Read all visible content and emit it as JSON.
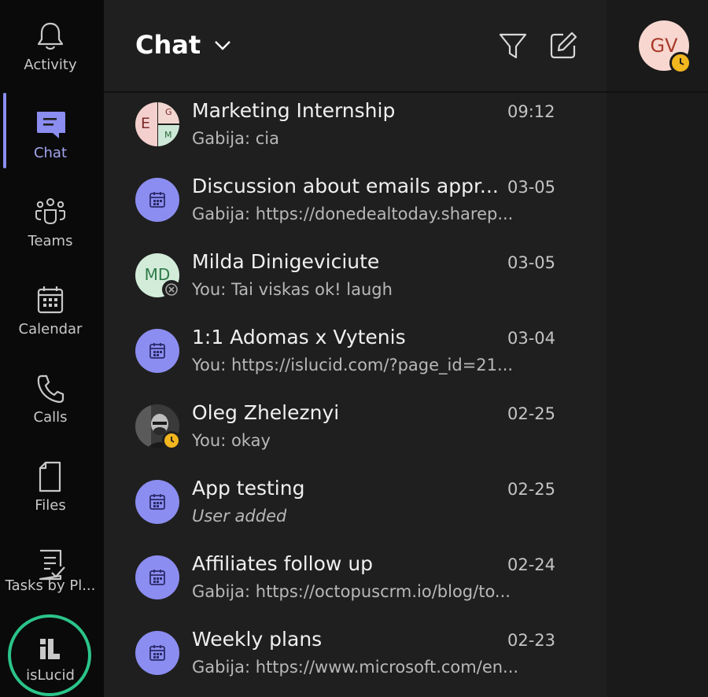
{
  "rail": {
    "items": [
      {
        "label": "Activity",
        "icon": "bell-icon"
      },
      {
        "label": "Chat",
        "icon": "chat-icon",
        "active": true
      },
      {
        "label": "Teams",
        "icon": "teams-icon"
      },
      {
        "label": "Calendar",
        "icon": "calendar-icon"
      },
      {
        "label": "Calls",
        "icon": "phone-icon"
      },
      {
        "label": "Files",
        "icon": "file-icon"
      },
      {
        "label": "Tasks by Pl...",
        "icon": "tasks-icon"
      },
      {
        "label": "isLucid",
        "icon": "islucid-icon"
      }
    ]
  },
  "header": {
    "title": "Chat"
  },
  "me": {
    "initials": "GV",
    "status": "away"
  },
  "chats": [
    {
      "name": "Marketing Internship",
      "time": "09:12",
      "preview": "Gabija: cia",
      "avatar_type": "group",
      "avatar_letters": {
        "main": "E",
        "top": "G",
        "bottom": "M"
      }
    },
    {
      "name": "Discussion about emails appr...",
      "time": "03-05",
      "preview": "Gabija: https://donedealtoday.sharep...",
      "avatar_type": "meeting"
    },
    {
      "name": "Milda Dinigeviciute",
      "time": "03-05",
      "preview": "You: Tai viskas ok! laugh",
      "avatar_type": "initials",
      "avatar_initials": "MD",
      "status": "offline"
    },
    {
      "name": "1:1 Adomas x Vytenis",
      "time": "03-04",
      "preview": "You: https://islucid.com/?page_id=21...",
      "avatar_type": "meeting"
    },
    {
      "name": "Oleg Zheleznyi",
      "time": "02-25",
      "preview": "You: okay",
      "avatar_type": "photo",
      "status": "away"
    },
    {
      "name": "App testing",
      "time": "02-25",
      "preview": "User added",
      "preview_italic": true,
      "avatar_type": "meeting"
    },
    {
      "name": "Affiliates follow up",
      "time": "02-24",
      "preview": "Gabija: https://octopuscrm.io/blog/to...",
      "avatar_type": "meeting"
    },
    {
      "name": "Weekly plans",
      "time": "02-23",
      "preview": "Gabija: https://www.microsoft.com/en...",
      "avatar_type": "meeting"
    }
  ],
  "colors": {
    "accent": "#8b8df0",
    "highlight_ring": "#2bc48a",
    "away": "#f2b61f"
  }
}
